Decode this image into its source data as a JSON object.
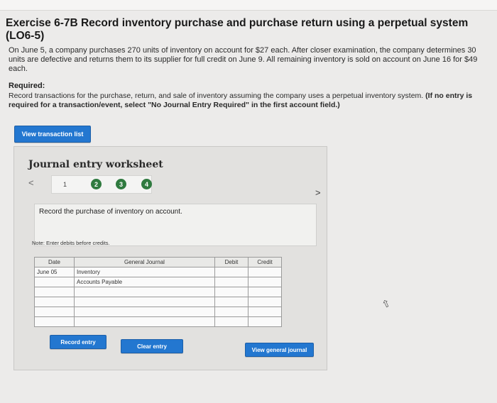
{
  "exercise": {
    "title": "Exercise 6-7B Record inventory purchase and purchase return using a perpetual system (LO6-5)",
    "description": "On June 5, a company purchases 270 units of inventory on account for $27 each. After closer examination, the company determines 30 units are defective and returns them to its supplier for full credit on June 9. All remaining inventory is sold on account on June 16 for $49 each.",
    "required_heading": "Required:",
    "required_text": "Record transactions for the purchase, return, and sale of inventory assuming the company uses a perpetual inventory system.",
    "required_bold": "(If no entry is required for a transaction/event, select \"No Journal Entry Required\" in the first account field.)"
  },
  "buttons": {
    "view_transaction_list": "View transaction list",
    "record_entry": "Record entry",
    "clear_entry": "Clear entry",
    "view_general_journal": "View general journal"
  },
  "worksheet": {
    "title": "Journal entry worksheet",
    "prev": "<",
    "next": ">",
    "steps": [
      "1",
      "2",
      "3",
      "4"
    ],
    "instruction": "Record the purchase of inventory on account.",
    "note": "Note: Enter debits before credits."
  },
  "journal": {
    "headers": {
      "date": "Date",
      "general_journal": "General Journal",
      "debit": "Debit",
      "credit": "Credit"
    },
    "rows": [
      {
        "date": "June 05",
        "account": "Inventory",
        "debit": "",
        "credit": ""
      },
      {
        "date": "",
        "account": "Accounts Payable",
        "debit": "",
        "credit": ""
      },
      {
        "date": "",
        "account": "",
        "debit": "",
        "credit": ""
      },
      {
        "date": "",
        "account": "",
        "debit": "",
        "credit": ""
      },
      {
        "date": "",
        "account": "",
        "debit": "",
        "credit": ""
      },
      {
        "date": "",
        "account": "",
        "debit": "",
        "credit": ""
      }
    ]
  },
  "colors": {
    "accent": "#2377d0",
    "step_complete": "#2f7a3f"
  }
}
